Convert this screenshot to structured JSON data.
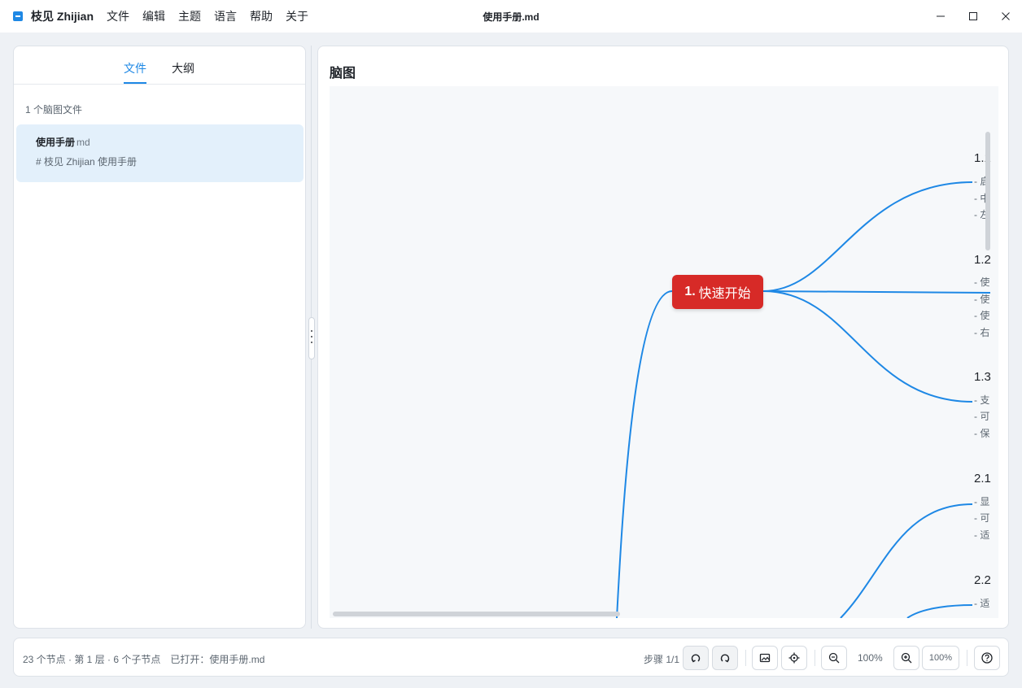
{
  "app": {
    "name": "枝见 Zhijian",
    "document_title": "使用手册.md"
  },
  "menu": [
    "文件",
    "编辑",
    "主题",
    "语言",
    "帮助",
    "关于"
  ],
  "sidebar": {
    "tabs": [
      {
        "label": "文件",
        "active": true
      },
      {
        "label": "大纲",
        "active": false
      }
    ],
    "file_count": "1 个脑图文件",
    "files": [
      {
        "name": "使用手册",
        "ext": "md",
        "preview": "# 枝见 Zhijian 使用手册",
        "selected": true
      }
    ]
  },
  "mindmap": {
    "panel_title": "脑图",
    "root": {
      "number": "1.",
      "label": "快速开始",
      "color": "#d72a27"
    },
    "link_color": "#1e88e5",
    "children": [
      {
        "title": "1.1",
        "lines": [
          "- 启",
          "- 中",
          "- 左"
        ]
      },
      {
        "title": "1.2",
        "lines": [
          "- 使",
          "- 使",
          "- 使",
          "- 右"
        ]
      },
      {
        "title": "1.3",
        "lines": [
          "- 支",
          "- 可",
          "- 保"
        ]
      },
      {
        "title": "2.1",
        "lines": [
          "- 显",
          "- 可",
          "- 适"
        ]
      },
      {
        "title": "2.2",
        "lines": [
          "- 适"
        ]
      }
    ]
  },
  "status": {
    "summary": "23 个节点 · 第 1 层 · 6 个子节点",
    "opened": "已打开：使用手册.md",
    "step": "步骤 1/1",
    "zoom_label": "100%",
    "zoom_box": "100%"
  },
  "toolbar_icons": [
    "undo-icon",
    "redo-icon",
    "image-export-icon",
    "locate-center-icon",
    "zoom-out-icon",
    "zoom-in-icon",
    "help-icon"
  ],
  "colors": {
    "accent": "#1e88e5",
    "root_node": "#d72a27",
    "selected_file_bg": "#e3f0fb"
  }
}
